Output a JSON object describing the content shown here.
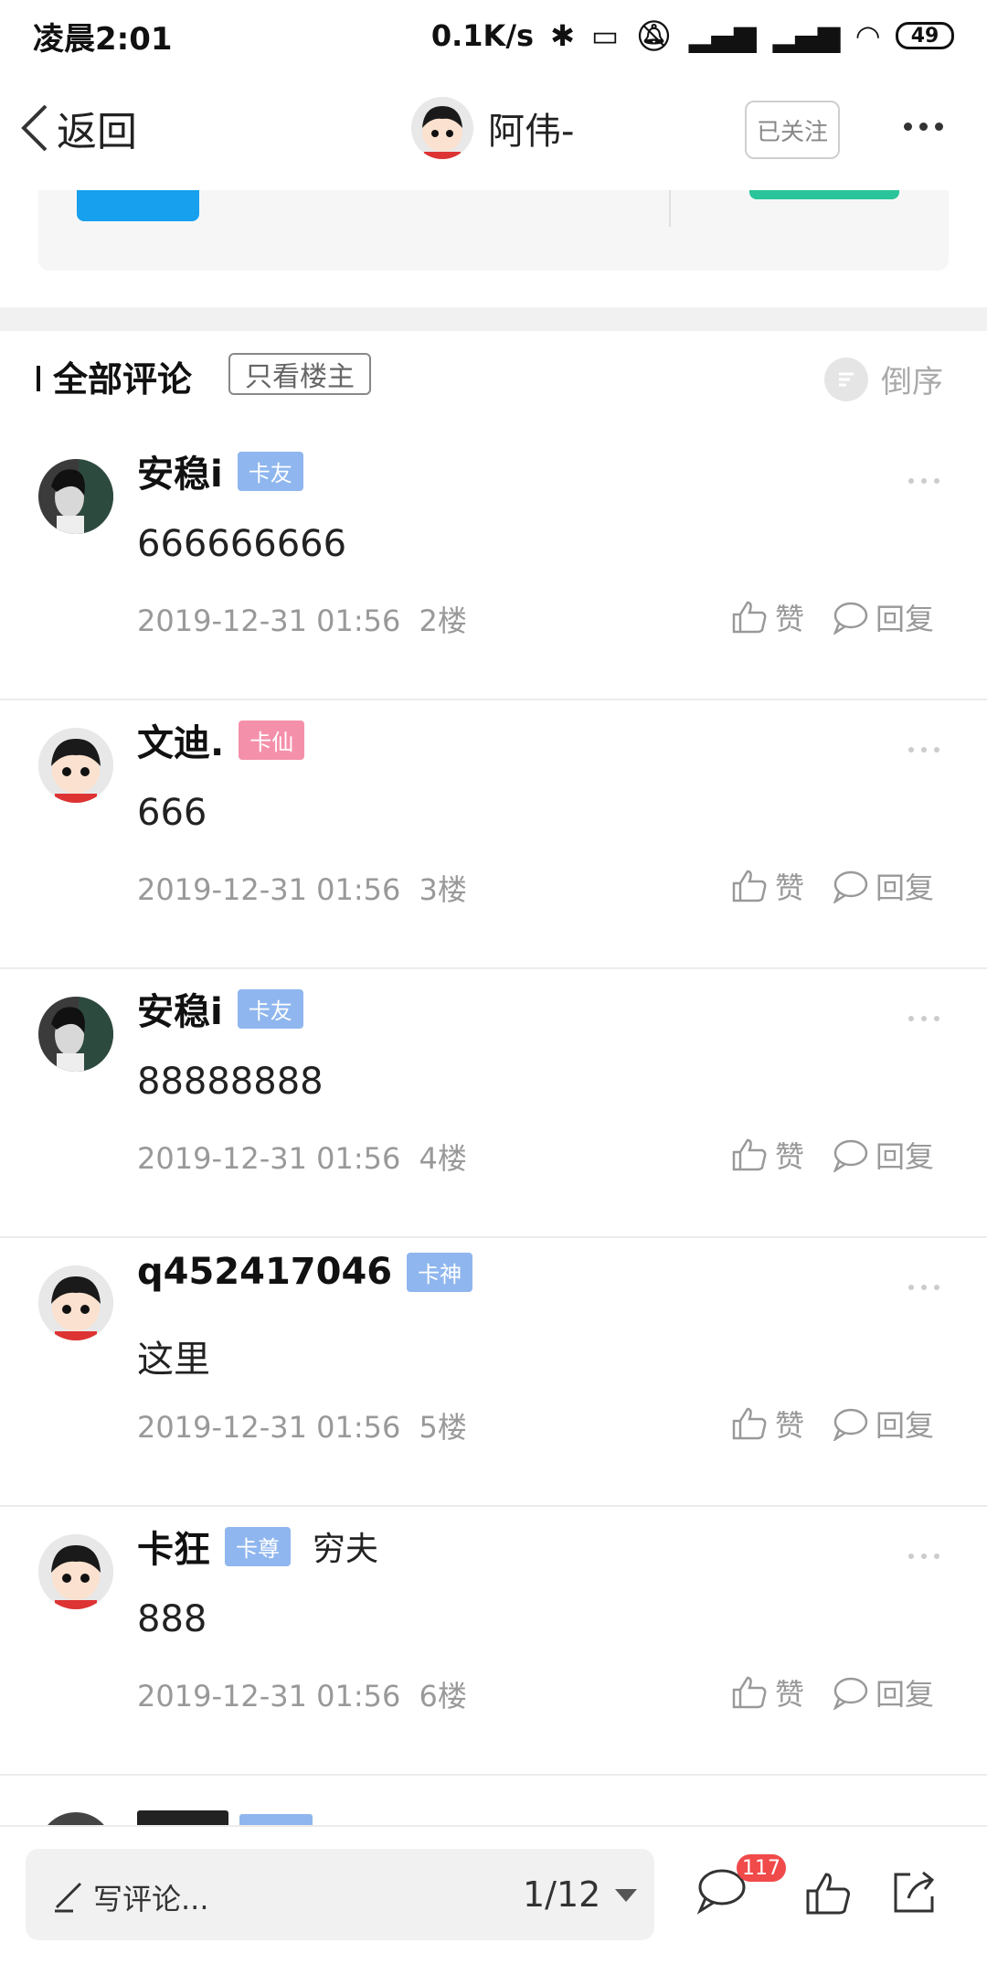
{
  "status_bar": {
    "time": "凌晨2:01",
    "net_speed": "0.1K/s",
    "battery": "49"
  },
  "nav": {
    "back_label": "返回",
    "username": "阿伟-",
    "follow_label": "已关注"
  },
  "comments_header": {
    "title": "全部评论",
    "only_op_label": "只看楼主",
    "sort_label": "倒序"
  },
  "comments": [
    {
      "name": "安稳i",
      "badge": "卡友",
      "badge_color": "#8fb6ee",
      "extra": "",
      "text": "666666666",
      "time": "2019-12-31 01:56",
      "floor": "2楼",
      "like_label": "赞",
      "reply_label": "回复"
    },
    {
      "name": "文迪.",
      "badge": "卡仙",
      "badge_color": "#f590ab",
      "extra": "",
      "text": "666",
      "time": "2019-12-31 01:56",
      "floor": "3楼",
      "like_label": "赞",
      "reply_label": "回复"
    },
    {
      "name": "安稳i",
      "badge": "卡友",
      "badge_color": "#8fb6ee",
      "extra": "",
      "text": "88888888",
      "time": "2019-12-31 01:56",
      "floor": "4楼",
      "like_label": "赞",
      "reply_label": "回复"
    },
    {
      "name": "q452417046",
      "badge": "卡神",
      "badge_color": "#8fb6ee",
      "extra": "",
      "text": "这里",
      "time": "2019-12-31 01:56",
      "floor": "5楼",
      "like_label": "赞",
      "reply_label": "回复"
    },
    {
      "name": "卡狂",
      "badge": "卡尊",
      "badge_color": "#8fb6ee",
      "extra": "穷夫",
      "text": "888",
      "time": "2019-12-31 01:56",
      "floor": "6楼",
      "like_label": "赞",
      "reply_label": "回复"
    }
  ],
  "bottom_bar": {
    "write_placeholder": "写评论...",
    "page": "1/12",
    "comment_count": "117"
  }
}
